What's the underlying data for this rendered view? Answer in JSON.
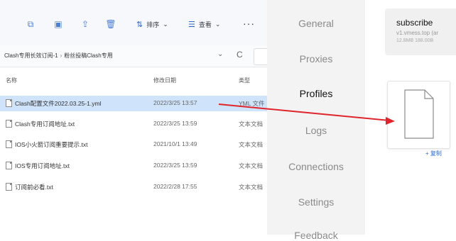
{
  "explorer": {
    "toolbar": {
      "sort_label": "排序",
      "view_label": "查看",
      "more_label": "···"
    },
    "address": {
      "path_parts": [
        "Clash专用长效订阅-1",
        "粉丝投稿Clash专用"
      ],
      "separator": "›",
      "chevron": "⌄",
      "refresh": "C"
    },
    "columns": {
      "name": "名称",
      "date": "修改日期",
      "type": "类型"
    },
    "files": [
      {
        "name": "Clash配置文件2022.03.25-1.yml",
        "date": "2022/3/25 13:57",
        "type": "YML 文件"
      },
      {
        "name": "Clash专用订阅地址.txt",
        "date": "2022/3/25 13:59",
        "type": "文本文档"
      },
      {
        "name": "IOS小火箭订阅重要提示.txt",
        "date": "2021/10/1 13:49",
        "type": "文本文档"
      },
      {
        "name": "IOS专用订阅地址.txt",
        "date": "2022/3/25 13:59",
        "type": "文本文档"
      },
      {
        "name": "订阅前必看.txt",
        "date": "2022/2/28 17:55",
        "type": "文本文档"
      }
    ]
  },
  "clash": {
    "nav": [
      "General",
      "Proxies",
      "Profiles",
      "Logs",
      "Connections",
      "Settings",
      "Feedback"
    ],
    "active": "Profiles",
    "profile": {
      "name": "subscribe",
      "url": "v1.vmess.top (ar",
      "meta": "12.8MB  188.00B"
    },
    "copy_label": "+ 复制"
  },
  "colors": {
    "arrow": "#e0242c",
    "selection": "#cfe3fb",
    "accent": "#2a6ad2"
  }
}
